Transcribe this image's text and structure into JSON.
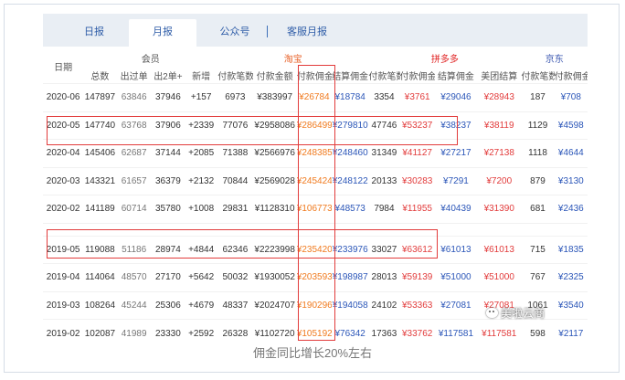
{
  "tabs": [
    {
      "label": "日报",
      "active": false
    },
    {
      "label": "月报",
      "active": true
    },
    {
      "label": "公众号",
      "active": false
    },
    {
      "label": "客服月报",
      "active": false
    }
  ],
  "table": {
    "group_headers": {
      "date": "日期",
      "members": "会员",
      "taobao": "淘宝",
      "pdd": "拼多多",
      "jd": "京东"
    },
    "columns": [
      "总数",
      "出过单",
      "出2单+",
      "新增",
      "付款笔数",
      "付款金额",
      "付款佣金",
      "结算佣金",
      "付款笔数",
      "付款佣金",
      "结算佣金",
      "美团结算",
      "付款笔数",
      "付款佣金"
    ],
    "rows": [
      {
        "date": "2020-06",
        "cells": [
          "147897",
          "63846",
          "37946",
          "+157",
          "6973",
          "¥383997",
          "¥26784",
          "¥18784",
          "3354",
          "¥3761",
          "¥29046",
          "¥28943",
          "187",
          "¥708"
        ]
      },
      {
        "date": "2020-05",
        "cells": [
          "147740",
          "63768",
          "37906",
          "+2339",
          "77076",
          "¥2958086",
          "¥286499",
          "¥279810",
          "47746",
          "¥53237",
          "¥38237",
          "¥38119",
          "1129",
          "¥4598"
        ]
      },
      {
        "date": "2020-04",
        "cells": [
          "145406",
          "62687",
          "37144",
          "+2085",
          "71388",
          "¥2566976",
          "¥248385",
          "¥248460",
          "31349",
          "¥41127",
          "¥27217",
          "¥27138",
          "1118",
          "¥4644"
        ]
      },
      {
        "date": "2020-03",
        "cells": [
          "143321",
          "61657",
          "36379",
          "+2132",
          "70844",
          "¥2569028",
          "¥245424",
          "¥248122",
          "20133",
          "¥30283",
          "¥7291",
          "¥7200",
          "879",
          "¥3130"
        ]
      },
      {
        "date": "2020-02",
        "cells": [
          "141189",
          "60714",
          "35780",
          "+1008",
          "29831",
          "¥1128310",
          "¥106773",
          "¥48573",
          "7984",
          "¥11955",
          "¥40439",
          "¥31390",
          "681",
          "¥2436"
        ]
      },
      {
        "date": "",
        "cells": [
          "",
          "",
          "",
          "",
          "",
          "",
          "",
          "",
          "",
          "",
          "",
          "",
          "",
          ""
        ]
      },
      {
        "date": "2019-05",
        "cells": [
          "119088",
          "51186",
          "28974",
          "+4844",
          "62346",
          "¥2223998",
          "¥235420",
          "¥233976",
          "33027",
          "¥63612",
          "¥61013",
          "¥61013",
          "715",
          "¥1835"
        ]
      },
      {
        "date": "2019-04",
        "cells": [
          "114064",
          "48570",
          "27170",
          "+5642",
          "50032",
          "¥1930052",
          "¥203593",
          "¥198987",
          "28013",
          "¥59139",
          "¥51000",
          "¥51000",
          "767",
          "¥2325"
        ]
      },
      {
        "date": "2019-03",
        "cells": [
          "108264",
          "45244",
          "25306",
          "+4679",
          "48337",
          "¥2024707",
          "¥190296",
          "¥194058",
          "24102",
          "¥53363",
          "¥27081",
          "¥27081",
          "1061",
          "¥3540"
        ]
      },
      {
        "date": "2019-02",
        "cells": [
          "102087",
          "41989",
          "23330",
          "+2592",
          "26328",
          "¥1102720",
          "¥105192",
          "¥76342",
          "17363",
          "¥33762",
          "¥117581",
          "¥117581",
          "598",
          "¥2117"
        ]
      }
    ]
  },
  "caption": "佣金同比增长20%左右",
  "watermark": "美啦云商",
  "colors": {
    "tab_text": "#2f5da8",
    "taobao": "#e8642c",
    "pdd": "#e02424",
    "jd": "#3a56b0",
    "highlight_box": "#e23b3b"
  }
}
